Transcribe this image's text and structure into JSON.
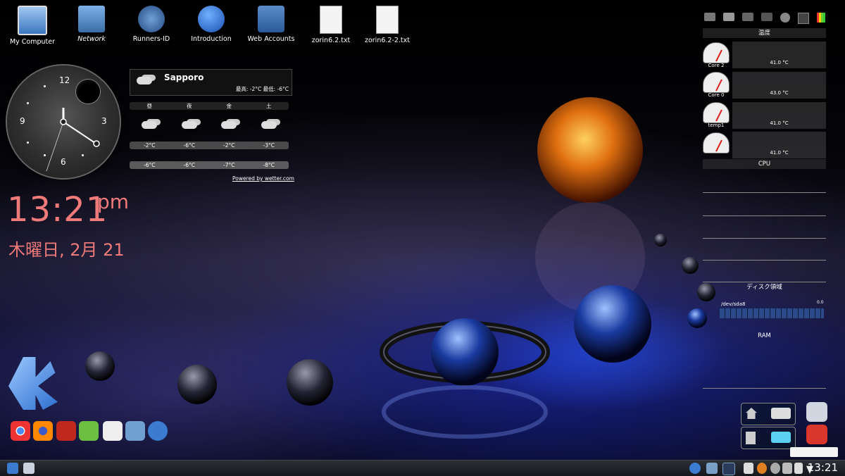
{
  "desktop_icons": [
    {
      "label": "My Computer",
      "icon": "computer-icon",
      "italic": false
    },
    {
      "label": "Network",
      "icon": "network-folder-icon",
      "italic": true
    },
    {
      "label": "Runners-ID",
      "icon": "compass-icon",
      "italic": false
    },
    {
      "label": "Introduction",
      "icon": "info-icon",
      "italic": false
    },
    {
      "label": "Web Accounts",
      "icon": "web-accounts-icon",
      "italic": false
    },
    {
      "label": "zorin6.2.txt",
      "icon": "text-file-icon",
      "italic": false
    },
    {
      "label": "zorin6.2-2.txt",
      "icon": "text-file-icon",
      "italic": false
    }
  ],
  "analog_clock": {
    "numbers": [
      "12",
      "3",
      "6",
      "9"
    ]
  },
  "digital_clock": {
    "time": "13:21",
    "ampm": "pm",
    "date": "木曜日, 2月 21"
  },
  "weather": {
    "city": "Sapporo",
    "hi_lo": "最高: -2°C 最低: -6°C",
    "days": [
      "昼",
      "夜",
      "金",
      "土"
    ],
    "highs": [
      "-2°C",
      "-6°C",
      "-2°C",
      "-3°C"
    ],
    "lows": [
      "-6°C",
      "-6°C",
      "-7°C",
      "-8°C"
    ],
    "powered_by": "Powered by wetter.com"
  },
  "sysmon": {
    "temp_title": "温度",
    "sensors": [
      {
        "label": "Core 2",
        "value": "41.0 °C"
      },
      {
        "label": "Core 0",
        "value": "43.0 °C"
      },
      {
        "label": "temp1",
        "value": "41.0 °C"
      },
      {
        "label": "",
        "value": "41.0 °C"
      }
    ],
    "cpu_title": "CPU",
    "disk_title": "ディスク領域",
    "disk_device": "/dev/sda8",
    "disk_value": "0.0",
    "ram_title": "RAM"
  },
  "taskbar": {
    "clock": "13:21"
  },
  "colors": {
    "clock_text": "#f07a7a",
    "accent": "#2a6cff"
  }
}
